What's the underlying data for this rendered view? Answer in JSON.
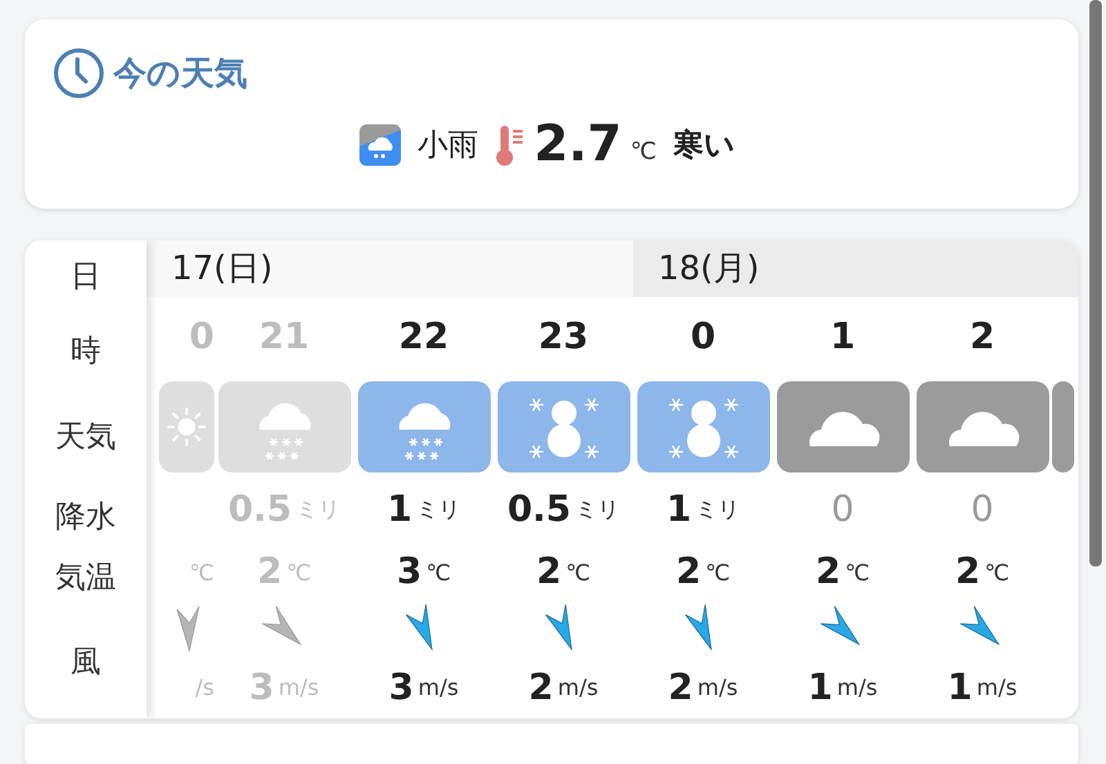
{
  "now": {
    "title": "今の天気",
    "weather": "小雨",
    "temperature": "2.7",
    "unit": "℃",
    "feeling": "寒い"
  },
  "labels": [
    "日",
    "時",
    "天気",
    "降水",
    "気温",
    "風"
  ],
  "days": [
    {
      "label": "17(日)"
    },
    {
      "label": "18(月)"
    }
  ],
  "hours": [
    {
      "kind": "sun",
      "past": true,
      "hour": "0",
      "temp_unit": "℃",
      "arrow": {
        "kind": "s"
      },
      "wind_unit": "/s"
    },
    {
      "kind": "snow",
      "past": true,
      "hour": "21",
      "dry": false,
      "precip": "0.5",
      "precip_unit": "ミリ",
      "temp": "2",
      "temp_unit": "℃",
      "arrow": {
        "kind": "se"
      },
      "wind_speed": "3",
      "wind_unit": "m/s"
    },
    {
      "kind": "snow",
      "past": false,
      "hour": "22",
      "dry": false,
      "precip": "1",
      "precip_unit": "ミリ",
      "temp": "3",
      "temp_unit": "℃",
      "arrow": {
        "kind": "sse"
      },
      "wind_speed": "3",
      "wind_unit": "m/s"
    },
    {
      "kind": "snowman",
      "past": false,
      "hour": "23",
      "dry": false,
      "precip": "0.5",
      "precip_unit": "ミリ",
      "temp": "2",
      "temp_unit": "℃",
      "arrow": {
        "kind": "sse"
      },
      "wind_speed": "2",
      "wind_unit": "m/s"
    },
    {
      "kind": "snowman",
      "past": false,
      "hour": "0",
      "dry": false,
      "precip": "1",
      "precip_unit": "ミリ",
      "temp": "2",
      "temp_unit": "℃",
      "arrow": {
        "kind": "sse"
      },
      "wind_speed": "2",
      "wind_unit": "m/s"
    },
    {
      "kind": "cloud",
      "past": false,
      "hour": "1",
      "dry": true,
      "precip": "0",
      "temp": "2",
      "temp_unit": "℃",
      "arrow": {
        "kind": "se"
      },
      "wind_speed": "1",
      "wind_unit": "m/s"
    },
    {
      "kind": "cloud",
      "past": false,
      "hour": "2",
      "dry": true,
      "precip": "0",
      "temp": "2",
      "temp_unit": "℃",
      "arrow": {
        "kind": "se"
      },
      "wind_speed": "1",
      "wind_unit": "m/s"
    },
    {
      "kind": "cloud",
      "past": false
    }
  ]
}
